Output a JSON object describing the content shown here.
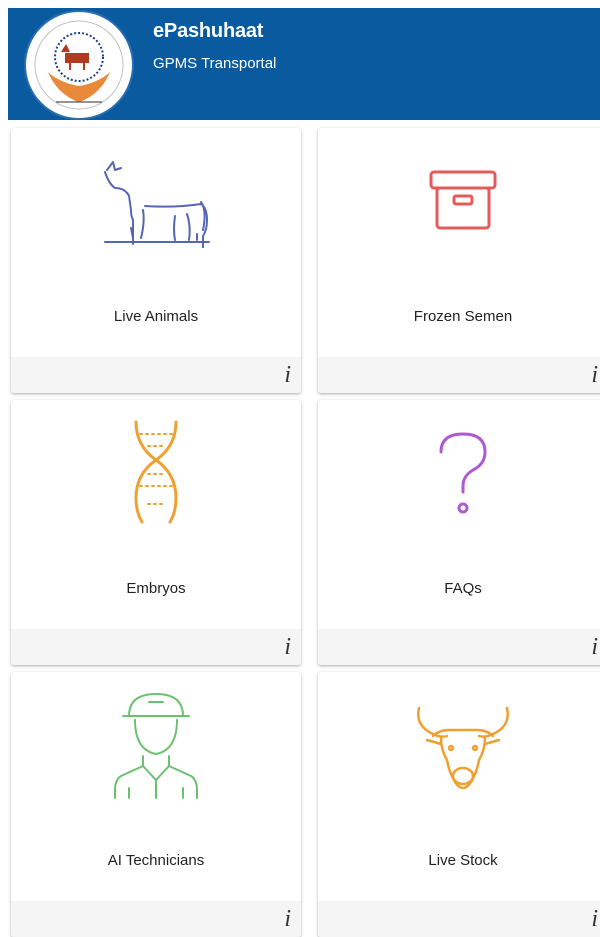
{
  "header": {
    "title": "ePashuhaat",
    "subtitle": "GPMS Transportal",
    "background_color": "#0a5aa0"
  },
  "tiles": [
    {
      "label": "Live Animals",
      "icon": "cow-icon",
      "color": "#5566b8",
      "info": "i"
    },
    {
      "label": "Frozen Semen",
      "icon": "box-icon",
      "color": "#e35b5b",
      "info": "i"
    },
    {
      "label": "Embryos",
      "icon": "dna-icon",
      "color": "#f0a030",
      "info": "i"
    },
    {
      "label": "FAQs",
      "icon": "question-mark-icon",
      "color": "#b05ad0",
      "info": "i"
    },
    {
      "label": "AI Technicians",
      "icon": "technician-icon",
      "color": "#6cc070",
      "info": "i"
    },
    {
      "label": "Live Stock",
      "icon": "bull-head-icon",
      "color": "#f0a030",
      "info": "i"
    }
  ]
}
